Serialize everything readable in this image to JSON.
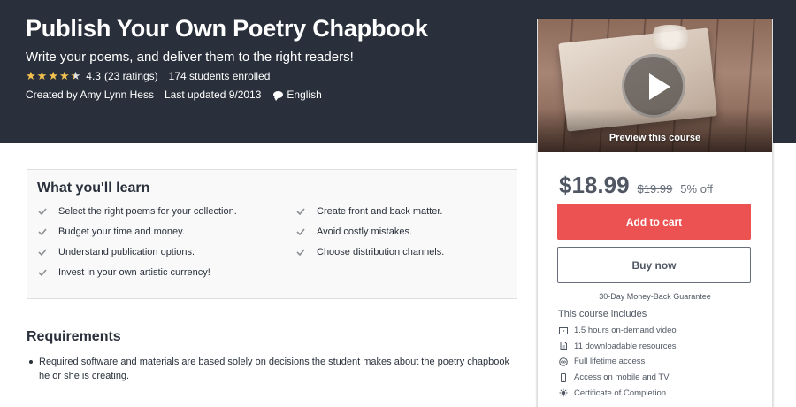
{
  "course": {
    "title": "Publish Your Own Poetry Chapbook",
    "subtitle": "Write your poems, and deliver them to the right readers!",
    "rating": 4.3,
    "rating_value": "4.3",
    "ratings_count": "(23 ratings)",
    "enrolled": "174 students enrolled",
    "created_by": "Created by Amy Lynn Hess",
    "last_updated": "Last updated 9/2013",
    "language": "English"
  },
  "sidebar": {
    "preview_label": "Preview this course",
    "price": "$18.99",
    "original_price": "$19.99",
    "discount": "5% off",
    "add_to_cart": "Add to cart",
    "buy_now": "Buy now",
    "guarantee": "30-Day Money-Back Guarantee",
    "includes_title": "This course includes",
    "includes": [
      {
        "icon": "video-icon",
        "label": "1.5 hours on-demand video"
      },
      {
        "icon": "file-icon",
        "label": "11 downloadable resources"
      },
      {
        "icon": "infinity-icon",
        "label": "Full lifetime access"
      },
      {
        "icon": "mobile-icon",
        "label": "Access on mobile and TV"
      },
      {
        "icon": "trophy-icon",
        "label": "Certificate of Completion"
      }
    ]
  },
  "learn": {
    "title": "What you'll learn",
    "items": [
      "Select the right poems for your collection.",
      "Budget your time and money.",
      "Understand publication options.",
      "Invest in your own artistic currency!",
      "Create front and back matter.",
      "Avoid costly mistakes.",
      "Choose distribution channels."
    ]
  },
  "requirements": {
    "title": "Requirements",
    "items": [
      "Required software and materials are based solely on decisions the student makes about the poetry chapbook he or she is creating."
    ]
  },
  "colors": {
    "hero_bg": "#29303b",
    "star": "#f4c150",
    "cart_button": "#ec5252"
  }
}
